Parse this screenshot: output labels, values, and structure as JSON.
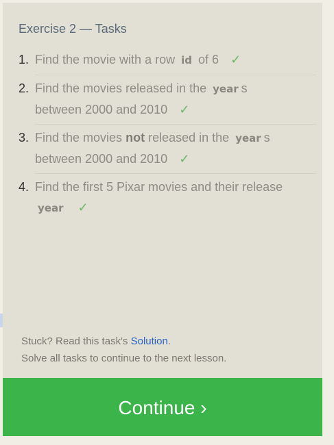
{
  "panel": {
    "title": "Exercise 2 — Tasks"
  },
  "tasks": [
    {
      "num": "1.",
      "parts": [
        "Find the movie with a row",
        "id",
        "of 6"
      ],
      "check": "✓"
    },
    {
      "num": "2.",
      "parts": [
        "Find the movies released in the",
        "year",
        "s",
        "between 2000 and 2010"
      ],
      "check": "✓"
    },
    {
      "num": "3.",
      "parts": [
        "Find the movies",
        "not",
        "released in the",
        "year",
        "s",
        "between 2000 and 2010"
      ],
      "check": "✓"
    },
    {
      "num": "4.",
      "parts": [
        "Find the first 5 Pixar movies and their release",
        "year"
      ],
      "check": "✓"
    }
  ],
  "help": {
    "stuck_prefix": "Stuck? Read this task's",
    "solution_link": "Solution",
    "stuck_suffix": ".",
    "continue_note": "Solve all tasks to continue to the next lesson."
  },
  "continue_button": {
    "label": "Continue ›"
  },
  "colors": {
    "accent_green": "#3bb54a",
    "check_green": "#6fb56a",
    "link_blue": "#2b63c4",
    "panel_bg": "#e2dfd4"
  }
}
